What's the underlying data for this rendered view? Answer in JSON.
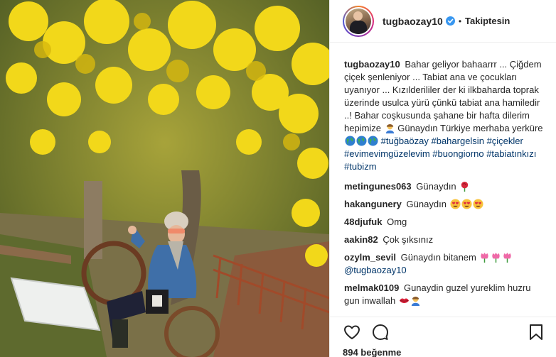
{
  "post": {
    "username": "tugbaozay10",
    "separator": "•",
    "follow_status": "Takiptesin",
    "caption": {
      "user": "tugbaozay10",
      "text": "Bahar geliyor bahaarrr ... Çiğdem çiçek şenleniyor ... Tabiat ana ve çocukları uyanıyor ... Kızılderililer der ki ilkbaharda toprak üzerinde usulca yürü çünkü tabiat ana hamiledir ..! Bahar coşkusunda şahane bir hafta dilerim hepimize",
      "text_after_emoji": "Günaydın Türkiye merhaba yerküre",
      "hashtags": [
        "#tuğbaözay",
        "#bahargelsin",
        "#çiçekler",
        "#evimevimgüzelevim",
        "#buongiorno",
        "#tabiatınkızı",
        "#tubizm"
      ]
    },
    "comments": [
      {
        "user": "metingunes063",
        "text": "Günaydın",
        "emojis": [
          "rose-emoji"
        ]
      },
      {
        "user": "hakangunery",
        "text": "Günaydın",
        "emojis": [
          "heart-eyes-emoji",
          "heart-eyes-emoji",
          "heart-eyes-emoji"
        ]
      },
      {
        "user": "48djufuk",
        "text": "Omg",
        "emojis": []
      },
      {
        "user": "aakin82",
        "text": "Çok şıksınız",
        "emojis": []
      },
      {
        "user": "ozylm_sevil",
        "text": "Günaydın bitanem",
        "emojis": [
          "tulip-emoji",
          "tulip-emoji",
          "tulip-emoji"
        ],
        "mention": "@tugbaozay10"
      },
      {
        "user": "melmak0109",
        "text": "Gunaydin guzel yureklim huzru gun inwallah",
        "emojis": [
          "kiss-lips-emoji",
          "woman-emoji"
        ]
      }
    ],
    "likes_label": "894 beğenme"
  },
  "colors": {
    "text": "#262626",
    "link": "#003569",
    "border": "#efefef",
    "verified": "#3897f0"
  }
}
